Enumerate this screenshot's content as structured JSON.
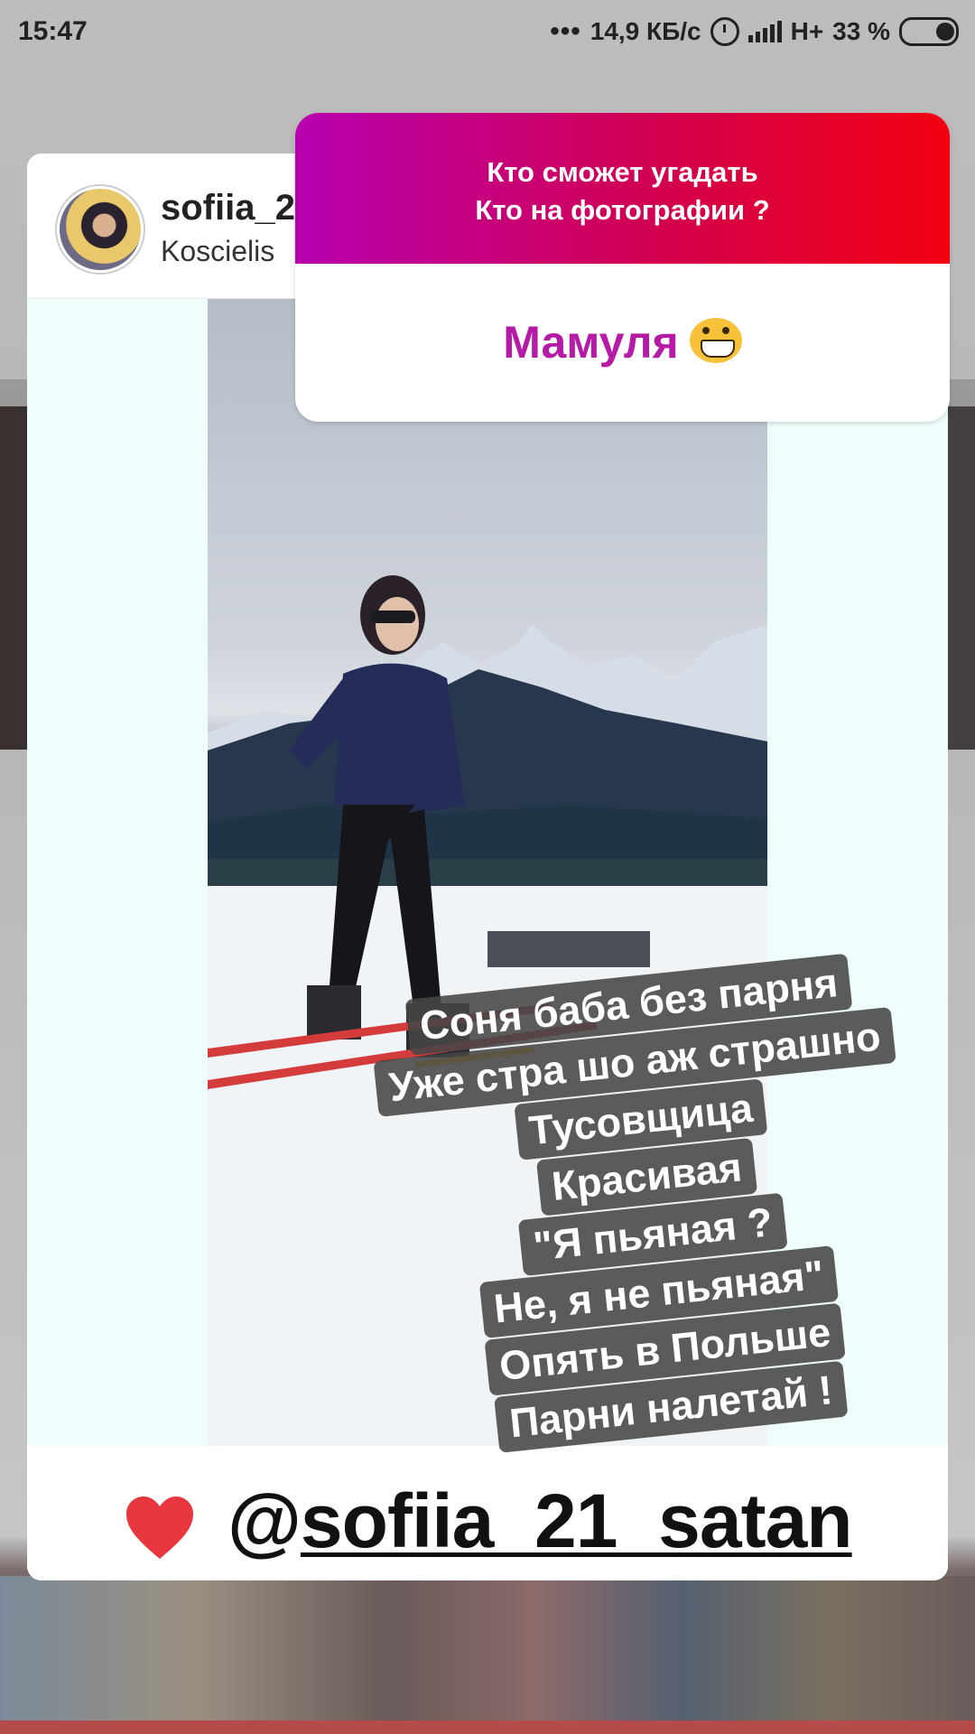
{
  "status_bar": {
    "time": "15:47",
    "dots": "•••",
    "speed": "14,9 КБ/с",
    "network": "H+",
    "battery": "33 %"
  },
  "post": {
    "username": "sofiia_21",
    "location": "Koscielis",
    "handle_at": "@",
    "handle_name": "sofiia_21_satan"
  },
  "question_sticker": {
    "line1": "Кто сможет угадать",
    "line2": "Кто на фотографии ?",
    "answer": "Мамуля"
  },
  "caption_lines": [
    "Соня баба без парня",
    "Уже стра шо аж страшно",
    "Тусовщица",
    "Красивая",
    "\"Я пьяная ?",
    "Не, я не пьяная\"",
    "Опять в Польше",
    "Парни налетай !"
  ],
  "colors": {
    "gradient_start": "#b800b0",
    "gradient_end": "#f20010",
    "answer_text": "#b51ba6",
    "heart": "#e8363e"
  },
  "icons": [
    "alarm-icon",
    "signal-icon",
    "battery-icon",
    "heart-icon",
    "grinning-emoji-icon"
  ]
}
